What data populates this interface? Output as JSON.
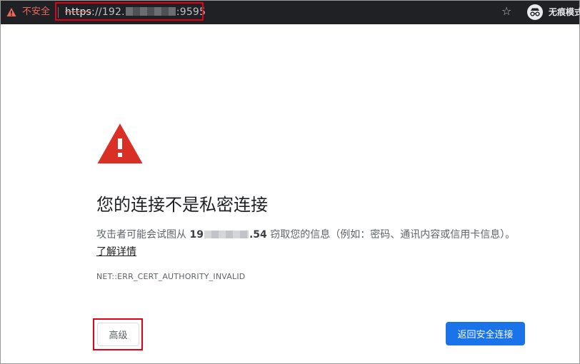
{
  "address_bar": {
    "security_label": "不安全",
    "url_scheme": "https",
    "url_sep": "://",
    "url_host_visible": "192.",
    "url_port_visible": ":9595"
  },
  "toolbar": {
    "incognito_label": "无痕模式"
  },
  "interstitial": {
    "title": "您的连接不是私密连接",
    "description_before": "攻击者可能会试图从 ",
    "ip_prefix": "19",
    "ip_suffix": ".54",
    "description_after": " 窃取您的信息（例如：密码、通讯内容或信用卡信息）。",
    "learn_more": "了解详情",
    "error_code": "NET::ERR_CERT_AUTHORITY_INVALID",
    "advanced_button": "高级",
    "back_button": "返回安全连接"
  },
  "colors": {
    "top_bar": "#202124",
    "warning_red": "#d93025",
    "primary_blue": "#1a73e8",
    "highlight_red": "#e2001a"
  }
}
